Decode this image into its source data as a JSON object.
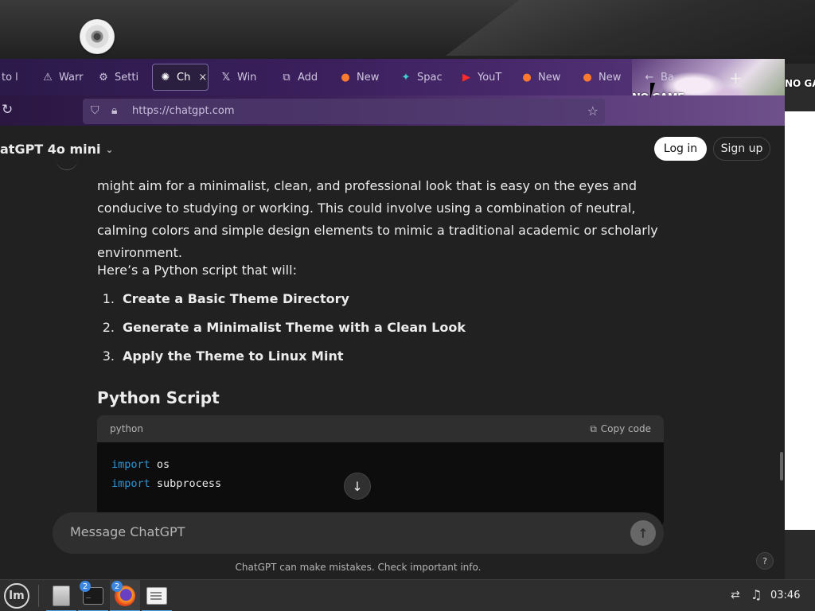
{
  "browser": {
    "tabs": [
      {
        "label": "to l",
        "icon": "page-icon"
      },
      {
        "label": "Warr",
        "icon": "warning-icon"
      },
      {
        "label": "Setti",
        "icon": "gear-icon"
      },
      {
        "label": "Ch",
        "icon": "chatgpt-icon",
        "active": true
      },
      {
        "label": "Win",
        "icon": "x-logo-icon"
      },
      {
        "label": "Add",
        "icon": "puzzle-icon"
      },
      {
        "label": "New",
        "icon": "firefox-icon"
      },
      {
        "label": "Spac",
        "icon": "spaces-icon"
      },
      {
        "label": "YouT",
        "icon": "youtube-icon"
      },
      {
        "label": "New",
        "icon": "firefox-icon"
      },
      {
        "label": "New",
        "icon": "firefox-icon"
      },
      {
        "label": "Ba",
        "icon": "back-icon"
      }
    ],
    "tab_close": "×",
    "new_tab": "+",
    "url": "https://chatgpt.com",
    "theme_text": "NO GAME",
    "theme_text_right": "NO GAME"
  },
  "header": {
    "model": "atGPT 4o mini",
    "login": "Log in",
    "signup": "Sign up"
  },
  "content": {
    "paragraph": "might aim for a minimalist, clean, and professional look that is easy on the eyes and conducive to studying or working. This could involve using a combination of neutral, calming colors and simple design elements to mimic a traditional academic or scholarly environment.",
    "intro": "Here’s a Python script that will:",
    "steps": [
      {
        "num": "1.",
        "text": "Create a Basic Theme Directory"
      },
      {
        "num": "2.",
        "text": "Generate a Minimalist Theme with a Clean Look"
      },
      {
        "num": "3.",
        "text": "Apply the Theme to Linux Mint"
      }
    ],
    "heading": "Python Script",
    "code": {
      "language": "python",
      "copy_label": "Copy code",
      "lines": [
        {
          "kw": "import",
          "rest": " os"
        },
        {
          "kw": "import",
          "rest": " subprocess"
        }
      ]
    }
  },
  "composer": {
    "placeholder": "Message ChatGPT"
  },
  "disclaimer": "ChatGPT can make mistakes. Check important info.",
  "help": "?",
  "taskbar": {
    "apps": [
      {
        "name": "files",
        "badge": ""
      },
      {
        "name": "terminal",
        "badge": "2"
      },
      {
        "name": "firefox",
        "badge": "2"
      },
      {
        "name": "text-editor",
        "badge": ""
      }
    ],
    "clock": "03:46"
  },
  "colors": {
    "page_bg": "#212121",
    "code_keyword": "#2e95d3",
    "taskbar_indicator": "#4da3e6"
  }
}
